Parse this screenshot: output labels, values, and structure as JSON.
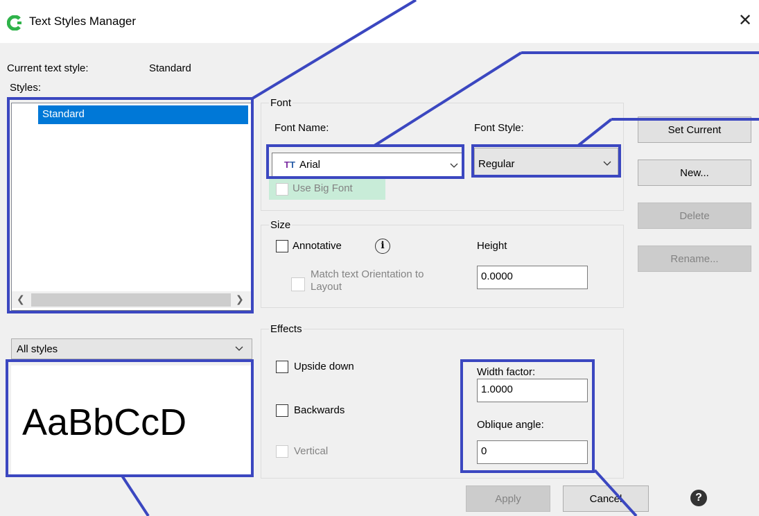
{
  "window": {
    "title": "Text Styles Manager",
    "close_glyph": "✕",
    "app_icon": "app-logo-icon"
  },
  "current_style": {
    "label": "Current text style:",
    "value": "Standard"
  },
  "styles": {
    "label": "Styles:",
    "items": [
      "Standard"
    ],
    "filter_value": "All styles"
  },
  "preview": {
    "sample": "AaBbCcD"
  },
  "font": {
    "group_label": "Font",
    "name_label": "Font Name:",
    "name_value": "Arial",
    "style_label": "Font Style:",
    "style_value": "Regular",
    "big_font_label": "Use Big Font"
  },
  "size": {
    "group_label": "Size",
    "annotative_label": "Annotative",
    "info_glyph": "i",
    "match_label_1": "Match text Orientation to",
    "match_label_2": "Layout",
    "height_label": "Height",
    "height_value": "0.0000"
  },
  "effects": {
    "group_label": "Effects",
    "upside_down_label": "Upside down",
    "backwards_label": "Backwards",
    "vertical_label": "Vertical",
    "width_factor_label": "Width factor:",
    "width_factor_value": "1.0000",
    "oblique_label": "Oblique angle:",
    "oblique_value": "0"
  },
  "buttons": {
    "set_current": "Set Current",
    "new": "New...",
    "delete": "Delete",
    "rename": "Rename...",
    "apply": "Apply",
    "cancel": "Cancel",
    "help_glyph": "?"
  },
  "colors": {
    "accent": "#0078d7",
    "annotation": "#3b47c0",
    "highlight": "#c8ecd8"
  }
}
